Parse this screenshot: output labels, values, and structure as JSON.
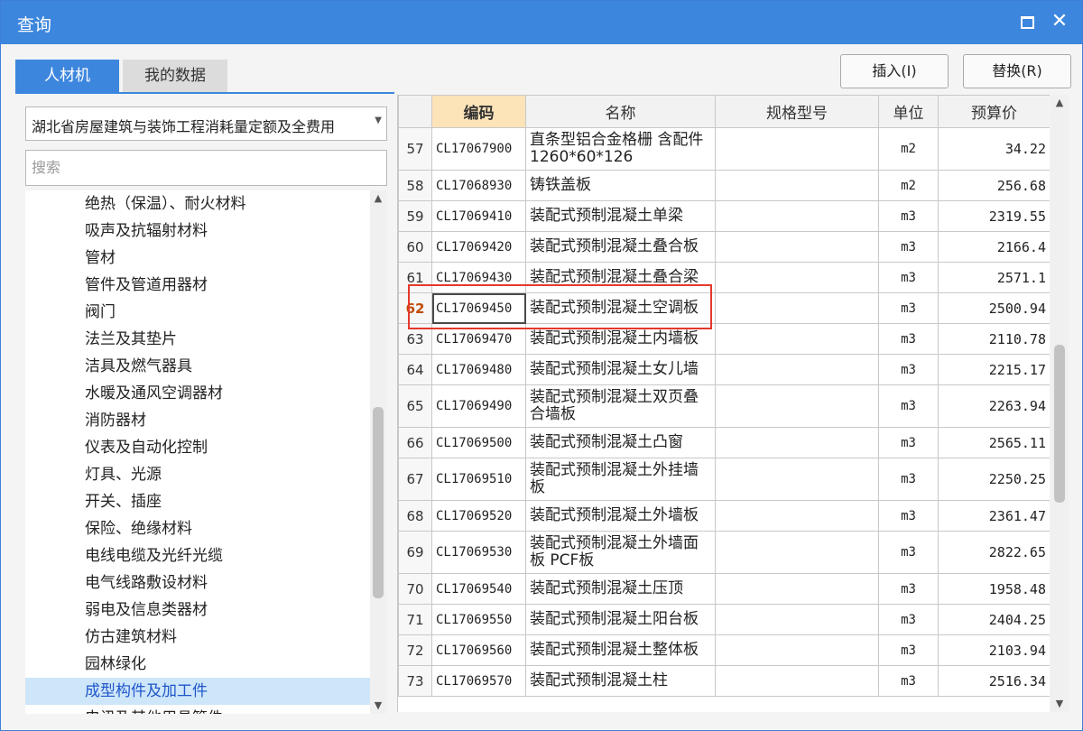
{
  "window": {
    "title": "查询"
  },
  "tabs": [
    {
      "label": "人材机"
    },
    {
      "label": "我的数据"
    }
  ],
  "buttons": {
    "insert": "插入(I)",
    "replace": "替换(R)"
  },
  "library_select": {
    "value": "湖北省房屋建筑与装饰工程消耗量定额及全费用"
  },
  "search": {
    "placeholder": "搜索"
  },
  "tree": {
    "items": [
      "绝热（保温）、耐火材料",
      "吸声及抗辐射材料",
      "管材",
      "管件及管道用器材",
      "阀门",
      "法兰及其垫片",
      "洁具及燃气器具",
      "水暖及通风空调器材",
      "消防器材",
      "仪表及自动化控制",
      "灯具、光源",
      "开关、插座",
      "保险、绝缘材料",
      "电线电缆及光纤光缆",
      "电气线路敷设材料",
      "弱电及信息类器材",
      "仿古建筑材料",
      "园林绿化",
      "成型构件及加工件",
      "电讯及其他用具管件"
    ],
    "selected": "成型构件及加工件"
  },
  "grid": {
    "columns": {
      "rownum": "",
      "code": "编码",
      "name": "名称",
      "spec": "规格型号",
      "unit": "单位",
      "price": "预算价"
    },
    "sorted_column": "code",
    "active_row": "62",
    "rows": [
      {
        "n": "57",
        "code": "CL17067900",
        "name": "直条型铝合金格栅 含配件 1260*60*126",
        "spec": "",
        "unit": "m2",
        "price": "34.22"
      },
      {
        "n": "58",
        "code": "CL17068930",
        "name": "铸铁盖板",
        "spec": "",
        "unit": "m2",
        "price": "256.68"
      },
      {
        "n": "59",
        "code": "CL17069410",
        "name": "装配式预制混凝土单梁",
        "spec": "",
        "unit": "m3",
        "price": "2319.55"
      },
      {
        "n": "60",
        "code": "CL17069420",
        "name": "装配式预制混凝土叠合板",
        "spec": "",
        "unit": "m3",
        "price": "2166.4"
      },
      {
        "n": "61",
        "code": "CL17069430",
        "name": "装配式预制混凝土叠合梁",
        "spec": "",
        "unit": "m3",
        "price": "2571.1"
      },
      {
        "n": "62",
        "code": "CL17069450",
        "name": "装配式预制混凝土空调板",
        "spec": "",
        "unit": "m3",
        "price": "2500.94"
      },
      {
        "n": "63",
        "code": "CL17069470",
        "name": "装配式预制混凝土内墙板",
        "spec": "",
        "unit": "m3",
        "price": "2110.78"
      },
      {
        "n": "64",
        "code": "CL17069480",
        "name": "装配式预制混凝土女儿墙",
        "spec": "",
        "unit": "m3",
        "price": "2215.17"
      },
      {
        "n": "65",
        "code": "CL17069490",
        "name": "装配式预制混凝土双页叠合墙板",
        "spec": "",
        "unit": "m3",
        "price": "2263.94"
      },
      {
        "n": "66",
        "code": "CL17069500",
        "name": "装配式预制混凝土凸窗",
        "spec": "",
        "unit": "m3",
        "price": "2565.11"
      },
      {
        "n": "67",
        "code": "CL17069510",
        "name": "装配式预制混凝土外挂墙板",
        "spec": "",
        "unit": "m3",
        "price": "2250.25"
      },
      {
        "n": "68",
        "code": "CL17069520",
        "name": "装配式预制混凝土外墙板",
        "spec": "",
        "unit": "m3",
        "price": "2361.47"
      },
      {
        "n": "69",
        "code": "CL17069530",
        "name": "装配式预制混凝土外墙面板 PCF板",
        "spec": "",
        "unit": "m3",
        "price": "2822.65"
      },
      {
        "n": "70",
        "code": "CL17069540",
        "name": "装配式预制混凝土压顶",
        "spec": "",
        "unit": "m3",
        "price": "1958.48"
      },
      {
        "n": "71",
        "code": "CL17069550",
        "name": "装配式预制混凝土阳台板",
        "spec": "",
        "unit": "m3",
        "price": "2404.25"
      },
      {
        "n": "72",
        "code": "CL17069560",
        "name": "装配式预制混凝土整体板",
        "spec": "",
        "unit": "m3",
        "price": "2103.94"
      },
      {
        "n": "73",
        "code": "CL17069570",
        "name": "装配式预制混凝土柱",
        "spec": "",
        "unit": "m3",
        "price": "2516.34"
      }
    ]
  },
  "colors": {
    "accent": "#3d86de",
    "selection_bg": "#cde6fa",
    "highlight_border": "#e5392b",
    "sorted_header_bg": "#fde4b8"
  },
  "icons": {
    "maximize": "maximize-icon",
    "close": "close-icon",
    "dropdown": "chevron-down-icon"
  }
}
